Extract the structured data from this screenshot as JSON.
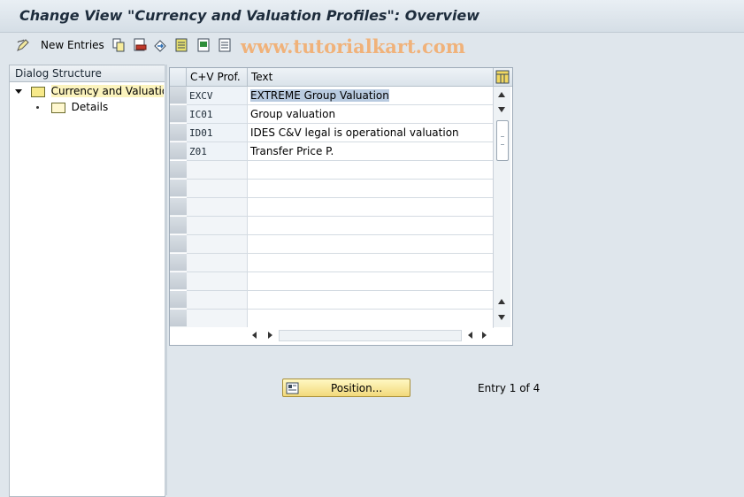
{
  "window": {
    "title": "Change View \"Currency and Valuation Profiles\": Overview"
  },
  "toolbar": {
    "new_entries_label": "New Entries",
    "icons": [
      "edit-pen-icon",
      "copy-icon",
      "delete-icon",
      "undo-icon",
      "select-all-icon",
      "select-block-icon",
      "deselect-all-icon"
    ]
  },
  "watermark": "www.tutorialkart.com",
  "dialog_structure": {
    "header": "Dialog Structure",
    "items": [
      {
        "label": "Currency and Valuation Profiles",
        "expanded": true,
        "selected": true
      },
      {
        "label": "Details",
        "expanded": false,
        "selected": false
      }
    ]
  },
  "table": {
    "columns": [
      "C+V Prof.",
      "Text"
    ],
    "rows": [
      {
        "key": "EXCV",
        "text": "EXTREME Group Valuation",
        "selected": true
      },
      {
        "key": "IC01",
        "text": "Group valuation",
        "selected": false
      },
      {
        "key": "ID01",
        "text": "IDES C&V legal is operational valuation",
        "selected": false
      },
      {
        "key": "Z01",
        "text": "Transfer Price P.",
        "selected": false
      }
    ],
    "empty_rows": 9
  },
  "actions": {
    "position_label": "Position..."
  },
  "status": {
    "entry_text": "Entry 1 of 4"
  },
  "colors": {
    "selection": "#b9cbe0",
    "button": "#f5dc86",
    "watermark": "#f0b27a"
  }
}
